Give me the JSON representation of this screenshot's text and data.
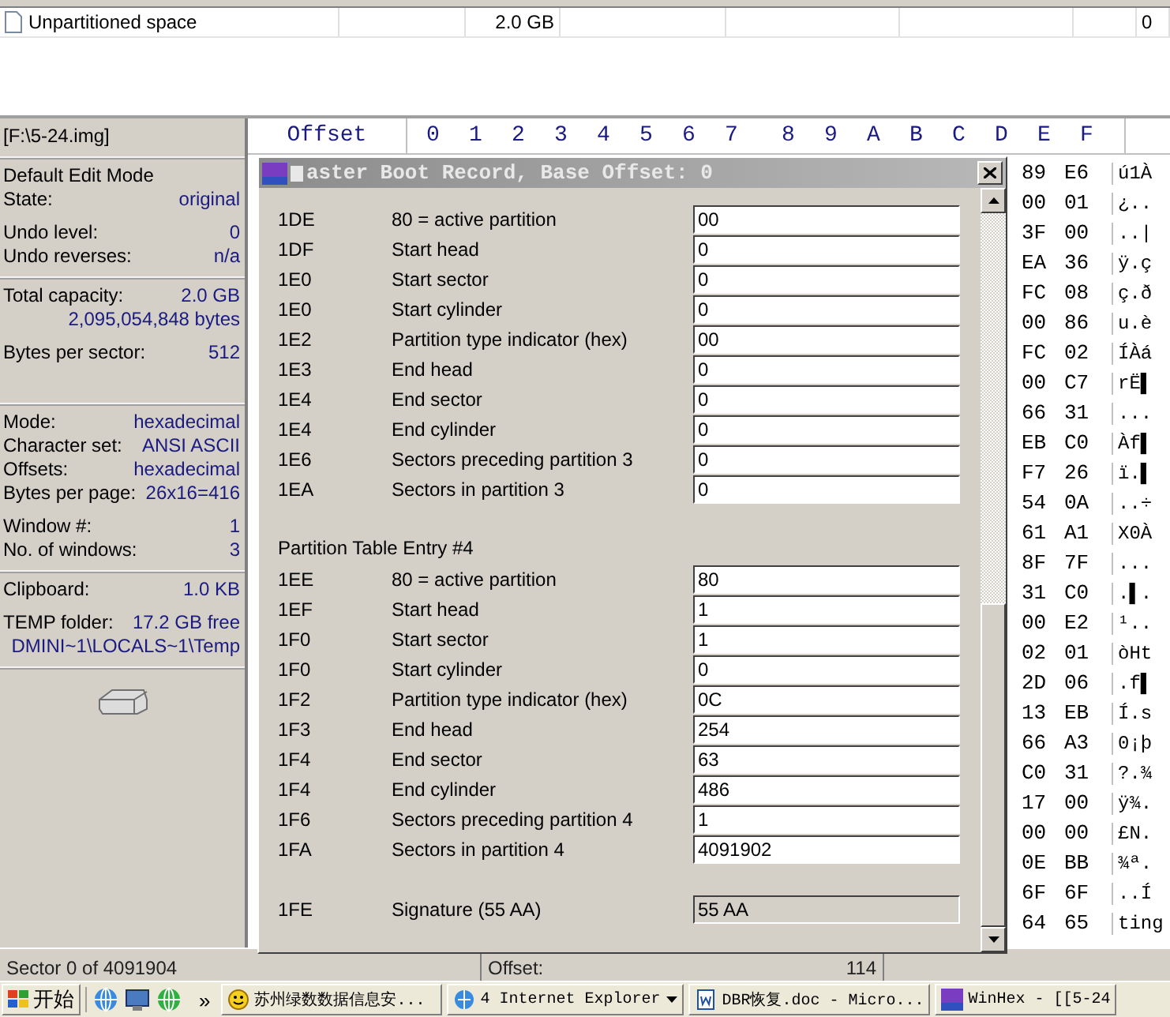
{
  "file_list": {
    "rows": [
      {
        "name": "Unpartitioned space",
        "size": "2.0 GB",
        "column_8": "0"
      }
    ]
  },
  "info_panel": {
    "sections": [
      {
        "blocks": [
          [
            {
              "label": "[F:\\5-24.img]"
            }
          ]
        ]
      },
      {
        "blocks": [
          [
            {
              "label": "Default Edit Mode"
            },
            {
              "label": "State:",
              "value": "original"
            }
          ],
          [
            {
              "label": "Undo level:",
              "value": "0"
            },
            {
              "label": "Undo reverses:",
              "value": "n/a"
            }
          ]
        ]
      },
      {
        "blocks": [
          [
            {
              "label": "Total capacity:",
              "value": "2.0 GB"
            },
            {
              "value": "2,095,054,848 bytes"
            }
          ],
          [
            {
              "label": "Bytes per sector:",
              "value": "512"
            }
          ]
        ]
      },
      {
        "blocks": [
          [
            {
              "label": "Mode:",
              "value": "hexadecimal"
            },
            {
              "label": "Character set:",
              "value": "ANSI ASCII"
            },
            {
              "label": "Offsets:",
              "value": "hexadecimal"
            },
            {
              "label": "Bytes per page:",
              "value": "26x16=416"
            }
          ],
          [
            {
              "label": "Window #:",
              "value": "1"
            },
            {
              "label": "No. of windows:",
              "value": "3"
            }
          ]
        ]
      },
      {
        "blocks": [
          [
            {
              "label": "Clipboard:",
              "value": "1.0 KB"
            }
          ],
          [
            {
              "label": "TEMP folder:",
              "value": "17.2 GB free"
            },
            {
              "value": "DMINI~1\\LOCALS~1\\Temp"
            }
          ]
        ]
      }
    ]
  },
  "hex_view": {
    "offset_label": "Offset",
    "columns": [
      "0",
      "1",
      "2",
      "3",
      "4",
      "5",
      "6",
      "7",
      "8",
      "9",
      "A",
      "B",
      "C",
      "D",
      "E",
      "F"
    ],
    "rows": [
      {
        "byte_e": "89",
        "byte_f": "E6",
        "text": "ú1À"
      },
      {
        "byte_e": "00",
        "byte_f": "01",
        "text": "¿.."
      },
      {
        "byte_e": "3F",
        "byte_f": "00",
        "text": "..|"
      },
      {
        "byte_e": "EA",
        "byte_f": "36",
        "text": "ÿ.ç"
      },
      {
        "byte_e": "FC",
        "byte_f": "08",
        "text": "ç.ð"
      },
      {
        "byte_e": "00",
        "byte_f": "86",
        "text": "u.è"
      },
      {
        "byte_e": "FC",
        "byte_f": "02",
        "text": "ÍÀá"
      },
      {
        "byte_e": "00",
        "byte_f": "C7",
        "text": "rË▌"
      },
      {
        "byte_e": "66",
        "byte_f": "31",
        "text": "..."
      },
      {
        "byte_e": "EB",
        "byte_f": "C0",
        "text": "Àf▌"
      },
      {
        "byte_e": "F7",
        "byte_f": "26",
        "text": "ï.▌"
      },
      {
        "byte_e": "54",
        "byte_f": "0A",
        "text": "..÷"
      },
      {
        "byte_e": "61",
        "byte_f": "A1",
        "text": "X0À"
      },
      {
        "byte_e": "8F",
        "byte_f": "7F",
        "text": "..."
      },
      {
        "byte_e": "31",
        "byte_f": "C0",
        "text": ".▌."
      },
      {
        "byte_e": "00",
        "byte_f": "E2",
        "text": "¹.."
      },
      {
        "byte_e": "02",
        "byte_f": "01",
        "text": "òHt"
      },
      {
        "byte_e": "2D",
        "byte_f": "06",
        "text": ".f▌"
      },
      {
        "byte_e": "13",
        "byte_f": "EB",
        "text": "Í.s"
      },
      {
        "byte_e": "66",
        "byte_f": "A3",
        "text": "0¡þ"
      },
      {
        "byte_e": "C0",
        "byte_f": "31",
        "text": "?.¾"
      },
      {
        "byte_e": "17",
        "byte_f": "00",
        "text": "ÿ¾."
      },
      {
        "byte_e": "00",
        "byte_f": "00",
        "text": "£N."
      },
      {
        "byte_e": "0E",
        "byte_f": "BB",
        "text": "¾ª."
      },
      {
        "byte_e": "6F",
        "byte_f": "6F",
        "text": "..Í"
      },
      {
        "byte_e": "64",
        "byte_f": "65",
        "text": "ting"
      }
    ]
  },
  "dialog": {
    "title": "aster Boot Record, Base Offset: 0",
    "sections": [
      {
        "rows": [
          {
            "offset": "1DE",
            "label": "80 = active partition",
            "value": "00",
            "disabled": false
          },
          {
            "offset": "1DF",
            "label": "Start head",
            "value": "0",
            "disabled": false
          },
          {
            "offset": "1E0",
            "label": "Start sector",
            "value": "0",
            "disabled": false
          },
          {
            "offset": "1E0",
            "label": "Start cylinder",
            "value": "0",
            "disabled": false
          },
          {
            "offset": "1E2",
            "label": "Partition type indicator (hex)",
            "value": "00",
            "disabled": false
          },
          {
            "offset": "1E3",
            "label": "End head",
            "value": "0",
            "disabled": false
          },
          {
            "offset": "1E4",
            "label": "End sector",
            "value": "0",
            "disabled": false
          },
          {
            "offset": "1E4",
            "label": "End cylinder",
            "value": "0",
            "disabled": false
          },
          {
            "offset": "1E6",
            "label": "Sectors preceding partition 3",
            "value": "0",
            "disabled": false
          },
          {
            "offset": "1EA",
            "label": "Sectors in partition 3",
            "value": "0",
            "disabled": false
          }
        ]
      },
      {
        "heading": "Partition Table Entry #4",
        "rows": [
          {
            "offset": "1EE",
            "label": "80 = active partition",
            "value": "80",
            "disabled": false
          },
          {
            "offset": "1EF",
            "label": "Start head",
            "value": "1",
            "disabled": false
          },
          {
            "offset": "1F0",
            "label": "Start sector",
            "value": "1",
            "disabled": false
          },
          {
            "offset": "1F0",
            "label": "Start cylinder",
            "value": "0",
            "disabled": false
          },
          {
            "offset": "1F2",
            "label": "Partition type indicator (hex)",
            "value": "0C",
            "disabled": false
          },
          {
            "offset": "1F3",
            "label": "End head",
            "value": "254",
            "disabled": false
          },
          {
            "offset": "1F4",
            "label": "End sector",
            "value": "63",
            "disabled": false
          },
          {
            "offset": "1F4",
            "label": "End cylinder",
            "value": "486",
            "disabled": false
          },
          {
            "offset": "1F6",
            "label": "Sectors preceding partition 4",
            "value": "1",
            "disabled": false
          },
          {
            "offset": "1FA",
            "label": "Sectors in partition 4",
            "value": "4091902",
            "disabled": false
          }
        ]
      },
      {
        "rows": [
          {
            "offset": "1FE",
            "label": "Signature (55 AA)",
            "value": "55 AA",
            "disabled": true
          }
        ]
      }
    ]
  },
  "status_bar": {
    "sector": "Sector 0 of 4091904",
    "offset_label": "Offset:",
    "offset_value": "114"
  },
  "taskbar": {
    "start": "开始",
    "more": "»",
    "tasks": [
      {
        "kind": "smiley",
        "label": "苏州绿数数据信息安..."
      },
      {
        "kind": "browser-group",
        "label": "4 Internet Explorer"
      },
      {
        "kind": "document",
        "label": "DBR恢复.doc - Micro..."
      },
      {
        "kind": "hex",
        "label": "WinHex - [[5-24"
      }
    ]
  }
}
